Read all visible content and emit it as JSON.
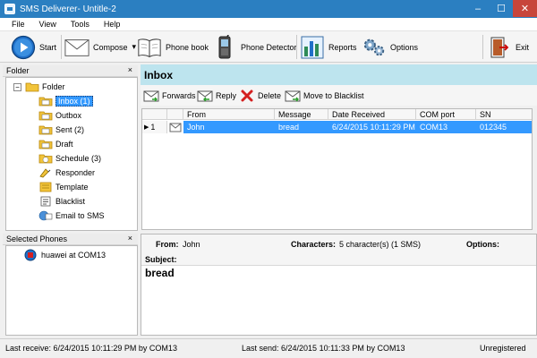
{
  "window": {
    "title": "SMS Deliverer- Untitle-2",
    "minimize": "–",
    "maximize": "☐",
    "close": "✕"
  },
  "menu": [
    "File",
    "View",
    "Tools",
    "Help"
  ],
  "toolbar": {
    "start": "Start",
    "compose": "Compose",
    "phone_book": "Phone book",
    "phone_detector": "Phone Detector",
    "reports": "Reports",
    "options": "Options",
    "exit": "Exit",
    "compose_dropdown": "▾"
  },
  "folder_panel": {
    "title": "Folder",
    "close": "×",
    "expander": "−",
    "root": "Folder",
    "items": [
      {
        "label": "Inbox (1)"
      },
      {
        "label": "Outbox"
      },
      {
        "label": "Sent (2)"
      },
      {
        "label": "Draft"
      },
      {
        "label": "Schedule (3)"
      },
      {
        "label": "Responder"
      },
      {
        "label": "Template"
      },
      {
        "label": "Blacklist"
      },
      {
        "label": "Email to SMS"
      }
    ]
  },
  "phones_panel": {
    "title": "Selected Phones",
    "close": "×",
    "items": [
      {
        "label": "huawei at COM13"
      }
    ]
  },
  "inbox": {
    "title": "Inbox",
    "actions": {
      "forwards": "Forwards",
      "reply": "Reply",
      "delete": "Delete",
      "move_blacklist": "Move to Blacklist"
    },
    "columns": {
      "from": "From",
      "message": "Message",
      "date": "Date Received",
      "com": "COM port",
      "sn": "SN"
    },
    "rows": [
      {
        "index": "1",
        "from": "John",
        "message": "bread",
        "date": "6/24/2015 10:11:29 PM",
        "com": "COM13",
        "sn": "012345"
      }
    ]
  },
  "detail": {
    "from_label": "From:",
    "from_value": "John",
    "chars_label": "Characters:",
    "chars_value": "5 character(s) (1 SMS)",
    "options_label": "Options:",
    "subject_label": "Subject:",
    "body": "bread"
  },
  "status": {
    "last_receive": "Last receive:  6/24/2015 10:11:29 PM by COM13",
    "last_send": "Last send:  6/24/2015 10:11:33 PM by COM13",
    "registration": "Unregistered"
  },
  "colors": {
    "title_bar": "#2b7fc1",
    "close_button": "#c7453b",
    "selection": "#3399ff",
    "inbox_header": "#bde4ee"
  }
}
